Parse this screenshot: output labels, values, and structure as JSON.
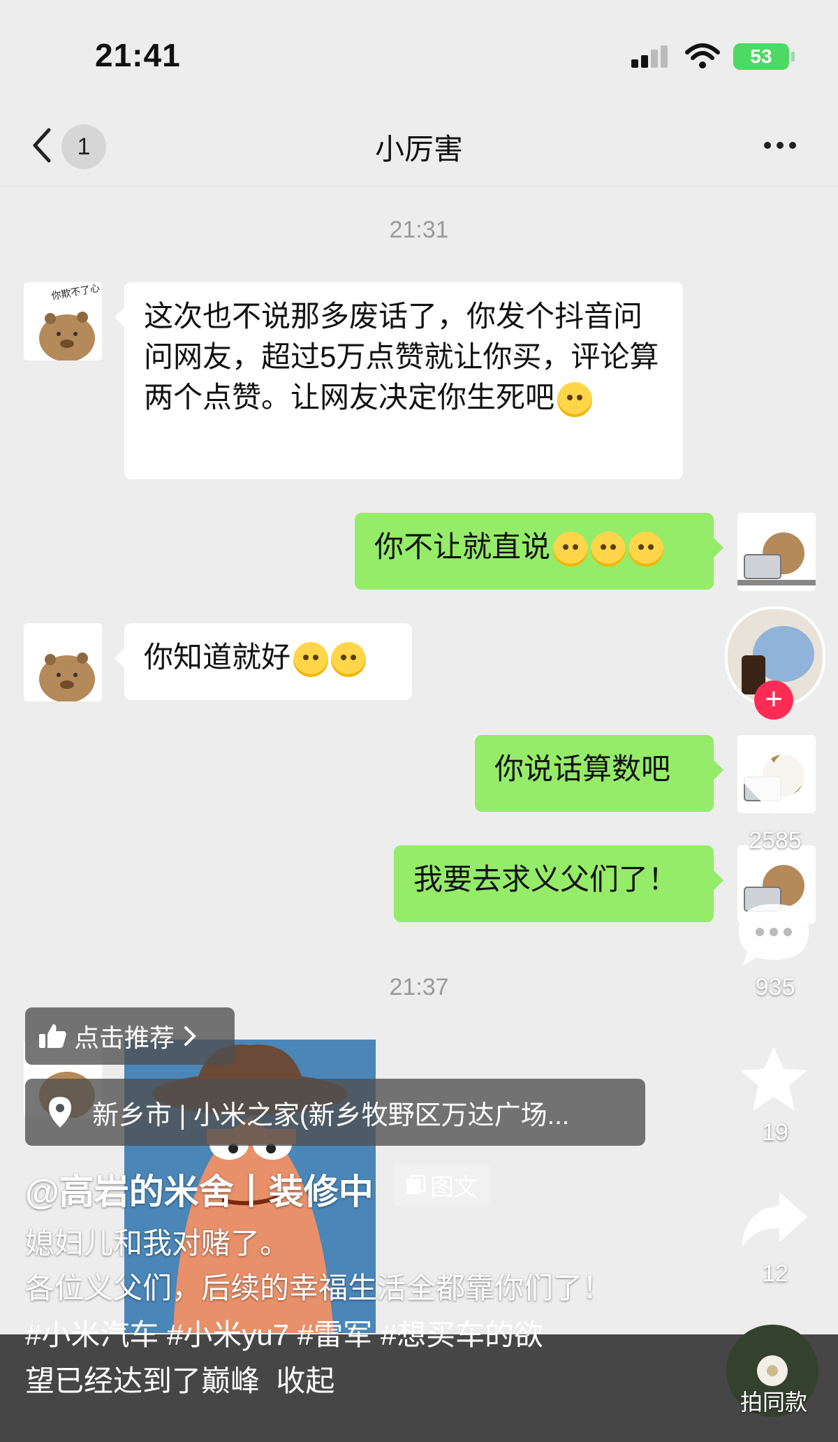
{
  "status": {
    "time": "21:41",
    "battery": "53"
  },
  "nav": {
    "badge": "1",
    "title": "小厉害"
  },
  "timestamps": [
    "21:31",
    "21:37"
  ],
  "messages": [
    {
      "side": "in",
      "text": "这次也不说那多废话了，你发个抖音问问网友，超过5万点赞就让你买，评论算两个点赞。让网友决定你生死吧",
      "emoji": "smirk-emoji"
    },
    {
      "side": "out",
      "text": "你不让就直说",
      "emoji": "eye-roll-emoji x3"
    },
    {
      "side": "in",
      "text": "你知道就好",
      "emoji": "smile-emoji x2"
    },
    {
      "side": "out",
      "text": "你说话算数吧"
    },
    {
      "side": "out",
      "text": "我要去求义父们了！"
    }
  ],
  "sticker_text": "我亦是，你欺不了心",
  "tiktok": {
    "recommend": "点击推荐",
    "location": "新乡市 | 小米之家(新乡牧野区万达广场...",
    "author": "@高岩的米舍丨装修中",
    "tag": "图文",
    "caption_line1": "媳妇儿和我对赌了。",
    "caption_line2": "各位义父们，后续的幸福生活全都靠你们了！",
    "caption_line3": "#小米汽车 #小米yu7 #雷军 #想买车的欲",
    "caption_line4": "望已经达到了巅峰",
    "collapse": "收起",
    "likes": "2585",
    "comments": "935",
    "favorites": "19",
    "shares": "12",
    "same_style": "拍同款"
  },
  "colors": {
    "chat_bg": "#ededed",
    "out_bubble": "#95ec69",
    "follow_red": "#fe2c55"
  }
}
